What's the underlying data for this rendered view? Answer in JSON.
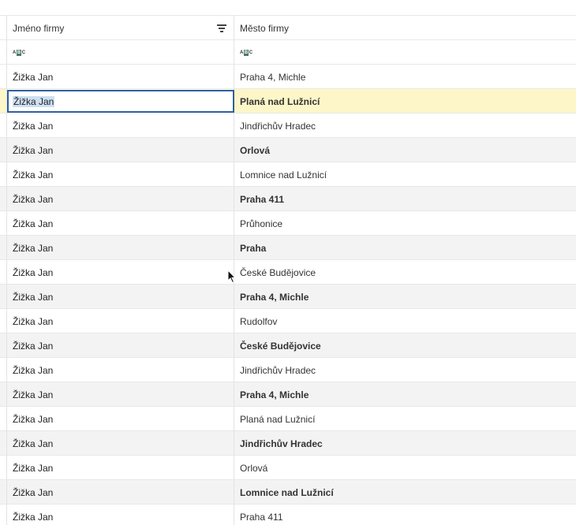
{
  "columns": [
    {
      "label": "Jméno firmy",
      "filter_icon": "filter-icon",
      "type_icon": "abc-type-icon"
    },
    {
      "label": "Město firmy",
      "type_icon": "abc-type-icon"
    }
  ],
  "type_icon_text": {
    "a": "A",
    "b": "B",
    "c": "C"
  },
  "selected_row_index": 1,
  "highlight_color": "#fdf6c8",
  "selection_border_color": "#2f5fa0",
  "rows": [
    {
      "name": "Žižka Jan",
      "city": "Praha 4, Michle"
    },
    {
      "name": "Žižka Jan",
      "city": "Planá nad Lužnicí"
    },
    {
      "name": "Žižka Jan",
      "city": "Jindřichův Hradec"
    },
    {
      "name": "Žižka Jan",
      "city": "Orlová"
    },
    {
      "name": "Žižka Jan",
      "city": "Lomnice nad Lužnicí"
    },
    {
      "name": "Žižka Jan",
      "city": "Praha 411"
    },
    {
      "name": "Žižka Jan",
      "city": "Průhonice"
    },
    {
      "name": "Žižka Jan",
      "city": "Praha"
    },
    {
      "name": "Žižka Jan",
      "city": "České Budějovice"
    },
    {
      "name": "Žižka Jan",
      "city": "Praha 4, Michle"
    },
    {
      "name": "Žižka Jan",
      "city": "Rudolfov"
    },
    {
      "name": "Žižka Jan",
      "city": "České Budějovice"
    },
    {
      "name": "Žižka Jan",
      "city": "Jindřichův Hradec"
    },
    {
      "name": "Žižka Jan",
      "city": "Praha 4, Michle"
    },
    {
      "name": "Žižka Jan",
      "city": "Planá nad Lužnicí"
    },
    {
      "name": "Žižka Jan",
      "city": "Jindřichův Hradec"
    },
    {
      "name": "Žižka Jan",
      "city": "Orlová"
    },
    {
      "name": "Žižka Jan",
      "city": "Lomnice nad Lužnicí"
    },
    {
      "name": "Žižka Jan",
      "city": "Praha 411"
    }
  ]
}
